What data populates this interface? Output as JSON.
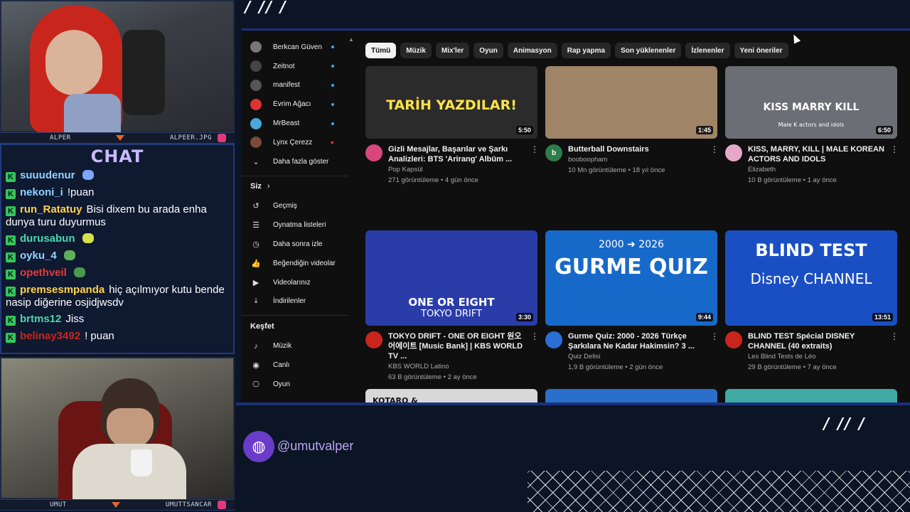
{
  "overlay": {
    "top_cam_left_name": "ALPER",
    "top_cam_right_name": "ALPEER.JPG",
    "bottom_cam_left_name": "UMUT",
    "bottom_cam_right_name": "UMUTTSANCAR",
    "chat_title": "CHAT",
    "handle": "@umutvalper",
    "accent_color": "#1b2f7a",
    "chat_title_color": "#c9b8ff"
  },
  "chat": {
    "messages": [
      {
        "user": "suuudenur",
        "text": "",
        "color": "#8fd3ff"
      },
      {
        "user": "nekoni_i",
        "text": "!puan",
        "color": "#8fd3ff"
      },
      {
        "user": "run_Ratatuy",
        "text": "Bisi dixem bu arada enha dunya turu duyurmus",
        "color": "#ffd24a"
      },
      {
        "user": "durusabun",
        "text": "",
        "color": "#4ad7b0"
      },
      {
        "user": "oyku_4",
        "text": "",
        "color": "#8fd3ff"
      },
      {
        "user": "opethveil",
        "text": "",
        "color": "#e33b3b"
      },
      {
        "user": "premsesmpanda",
        "text": "hiç açılmıyor kutu bende nasip diğerine osjidjwsdv",
        "color": "#ffd24a"
      },
      {
        "user": "brtms12",
        "text": "Jiss",
        "color": "#4ad7b0"
      },
      {
        "user": "belinay3492",
        "text": "! puan",
        "color": "#c8261c"
      }
    ]
  },
  "sidebar": {
    "subscriptions": [
      {
        "label": "Berkcan Güven",
        "icon": "avatar-icon",
        "badge": "new"
      },
      {
        "label": "Zeitnot",
        "icon": "avatar-icon",
        "badge": "new"
      },
      {
        "label": "manifest",
        "icon": "avatar-icon",
        "badge": "new"
      },
      {
        "label": "Evrim Ağacı",
        "icon": "avatar-icon",
        "badge": "new"
      },
      {
        "label": "MrBeast",
        "icon": "avatar-icon",
        "badge": "new"
      },
      {
        "label": "Lynx Çerezz",
        "icon": "avatar-icon",
        "badge": "live"
      }
    ],
    "show_more": "Daha fazla göster",
    "you_section": "Siz",
    "you_items": [
      {
        "label": "Geçmiş",
        "icon": "history-icon"
      },
      {
        "label": "Oynatma listeleri",
        "icon": "playlist-icon"
      },
      {
        "label": "Daha sonra izle",
        "icon": "clock-icon"
      },
      {
        "label": "Beğendiğin videolar",
        "icon": "thumbs-up-icon"
      },
      {
        "label": "Videolarınız",
        "icon": "video-icon"
      },
      {
        "label": "İndirilenler",
        "icon": "download-icon"
      }
    ],
    "explore_section": "Keşfet",
    "explore_items": [
      {
        "label": "Müzik",
        "icon": "music-icon"
      },
      {
        "label": "Canlı",
        "icon": "live-icon"
      },
      {
        "label": "Oyun",
        "icon": "gaming-icon"
      }
    ]
  },
  "chips": [
    "Tümü",
    "Müzik",
    "Mix'ler",
    "Oyun",
    "Animasyon",
    "Rap yapma",
    "Son yüklenenler",
    "İzlenenler",
    "Yeni öneriler"
  ],
  "videos": [
    {
      "title": "Gizli Mesajlar, Başarılar ve Şarkı Analizleri: BTS 'Arirang' Albüm ...",
      "channel": "Pop Kapsül",
      "stats": "271 görüntüleme • 4 gün önce",
      "duration": "5:50",
      "thumb_text": "TARİH YAZDILAR!",
      "thumb_color": "#2b2b2b",
      "avatar_color": "#d9477a"
    },
    {
      "title": "Butterball Downstairs",
      "channel": "booboopham",
      "stats": "10 Mn görüntüleme • 18 yıl önce",
      "duration": "1:45",
      "thumb_text": "",
      "thumb_color": "#a08468",
      "avatar_color": "#2e7d4a",
      "avatar_letter": "b"
    },
    {
      "title": "KISS, MARRY, KILL | MALE KOREAN ACTORS AND IDOLS",
      "channel": "Elizabeth",
      "stats": "10 B görüntüleme • 1 ay önce",
      "duration": "6:50",
      "thumb_text": "KISS   MARRY   KILL",
      "thumb_subtext": "Male K actors and idols",
      "thumb_color": "#6b6e75",
      "avatar_color": "#e6a8c8"
    },
    {
      "title": "TOKYO DRIFT - ONE OR EIGHT 원오어에이트 [Music Bank] | KBS WORLD TV ...",
      "channel": "KBS WORLD Latino",
      "stats": "63 B görüntüleme • 2 ay önce",
      "duration": "3:30",
      "thumb_text": "ONE OR EIGHT",
      "thumb_subtext": "TOKYO DRIFT",
      "thumb_color": "#2a3ca8",
      "avatar_color": "#c8261c"
    },
    {
      "title": "Gurme Quiz: 2000 - 2026 Türkçe Şarkılara Ne Kadar Hakimsin? 3 ...",
      "channel": "Quiz Delisi",
      "stats": "1,9 B görüntüleme • 2 gün önce",
      "duration": "9:44",
      "thumb_text": "GURME QUIZ",
      "thumb_subtext": "2000 ➜ 2026",
      "thumb_color": "#1769c9",
      "avatar_color": "#2a6fd6"
    },
    {
      "title": "BLIND TEST Spécial DISNEY CHANNEL (40 extraits)",
      "channel": "Les Blind Tests de Léo",
      "stats": "29 B görüntüleme • 7 ay önce",
      "duration": "13:51",
      "thumb_text": "BLIND TEST",
      "thumb_subtext": "Disney CHANNEL",
      "thumb_color": "#1a4fc4",
      "avatar_color": "#c8261c"
    },
    {
      "title": "",
      "channel": "",
      "stats": "",
      "duration": "",
      "thumb_text": "KOTARO & HANA",
      "thumb_color": "#d8d8d8",
      "avatar_color": "#0f0f0f"
    },
    {
      "title": "",
      "channel": "",
      "stats": "",
      "duration": "",
      "thumb_text": "",
      "thumb_color": "#2a6fc9",
      "avatar_color": "#0f0f0f"
    },
    {
      "title": "",
      "channel": "",
      "stats": "",
      "duration": "",
      "thumb_text": "",
      "thumb_color": "#3fa9a4",
      "avatar_color": "#0f0f0f"
    }
  ]
}
